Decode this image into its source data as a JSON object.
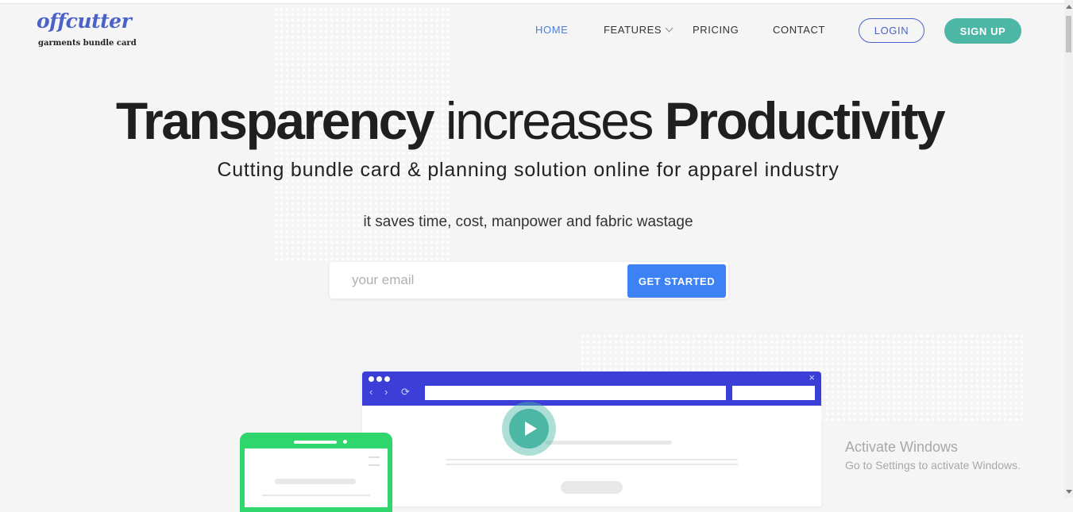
{
  "logo": {
    "name": "offcutter",
    "tagline": "garments bundle card"
  },
  "nav": {
    "home": "HOME",
    "features": "FEATURES",
    "pricing": "PRICING",
    "contact": "CONTACT",
    "login": "LOGIN",
    "signup": "SIGN UP"
  },
  "hero": {
    "headline_part1": "Transparency",
    "headline_part2": " increases ",
    "headline_part3": "Productivity",
    "subheading": "Cutting bundle card & planning solution online for apparel industry",
    "tagline": "it saves time, cost, manpower and fabric wastage",
    "email_placeholder": "your email",
    "email_value": "",
    "cta_label": "GET STARTED"
  },
  "illustration": {
    "browser_dots": 3,
    "play_icon": "play-icon",
    "close_glyph": "×",
    "back_glyph": "‹",
    "forward_glyph": "›",
    "reload_glyph": "⟳"
  },
  "watermark": {
    "title": "Activate Windows",
    "subtitle": "Go to Settings to activate Windows."
  },
  "colors": {
    "brand_blue": "#4a62c7",
    "teal": "#4cb7a5",
    "cta_blue": "#3d82f5",
    "browser_bar": "#3b3fd7",
    "phone_green": "#2ed66b"
  }
}
